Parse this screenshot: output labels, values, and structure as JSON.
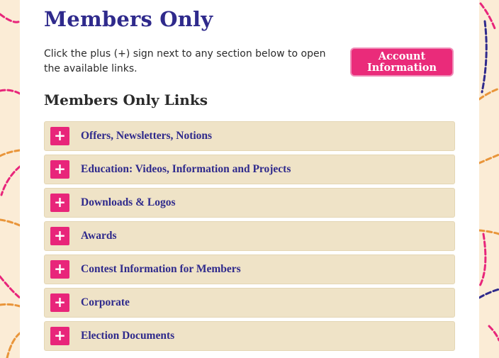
{
  "page": {
    "title": "Members Only",
    "intro": "Click the plus (+) sign next to any section below to open the available links.",
    "account_button": {
      "line1": "Account",
      "line2": "Information"
    },
    "section_title": "Members Only Links"
  },
  "accordion": {
    "expand_icon_glyph": "+",
    "items": [
      {
        "label": "Offers, Newsletters, Notions"
      },
      {
        "label": "Education: Videos, Information and Projects"
      },
      {
        "label": "Downloads & Logos"
      },
      {
        "label": "Awards"
      },
      {
        "label": "Contest Information for Members"
      },
      {
        "label": "Corporate"
      },
      {
        "label": "Election Documents"
      }
    ]
  },
  "colors": {
    "background": "#fbecd6",
    "accent_pink": "#e8257a",
    "title_blue": "#2f2a8c",
    "accordion_bg": "#efe3c7"
  }
}
